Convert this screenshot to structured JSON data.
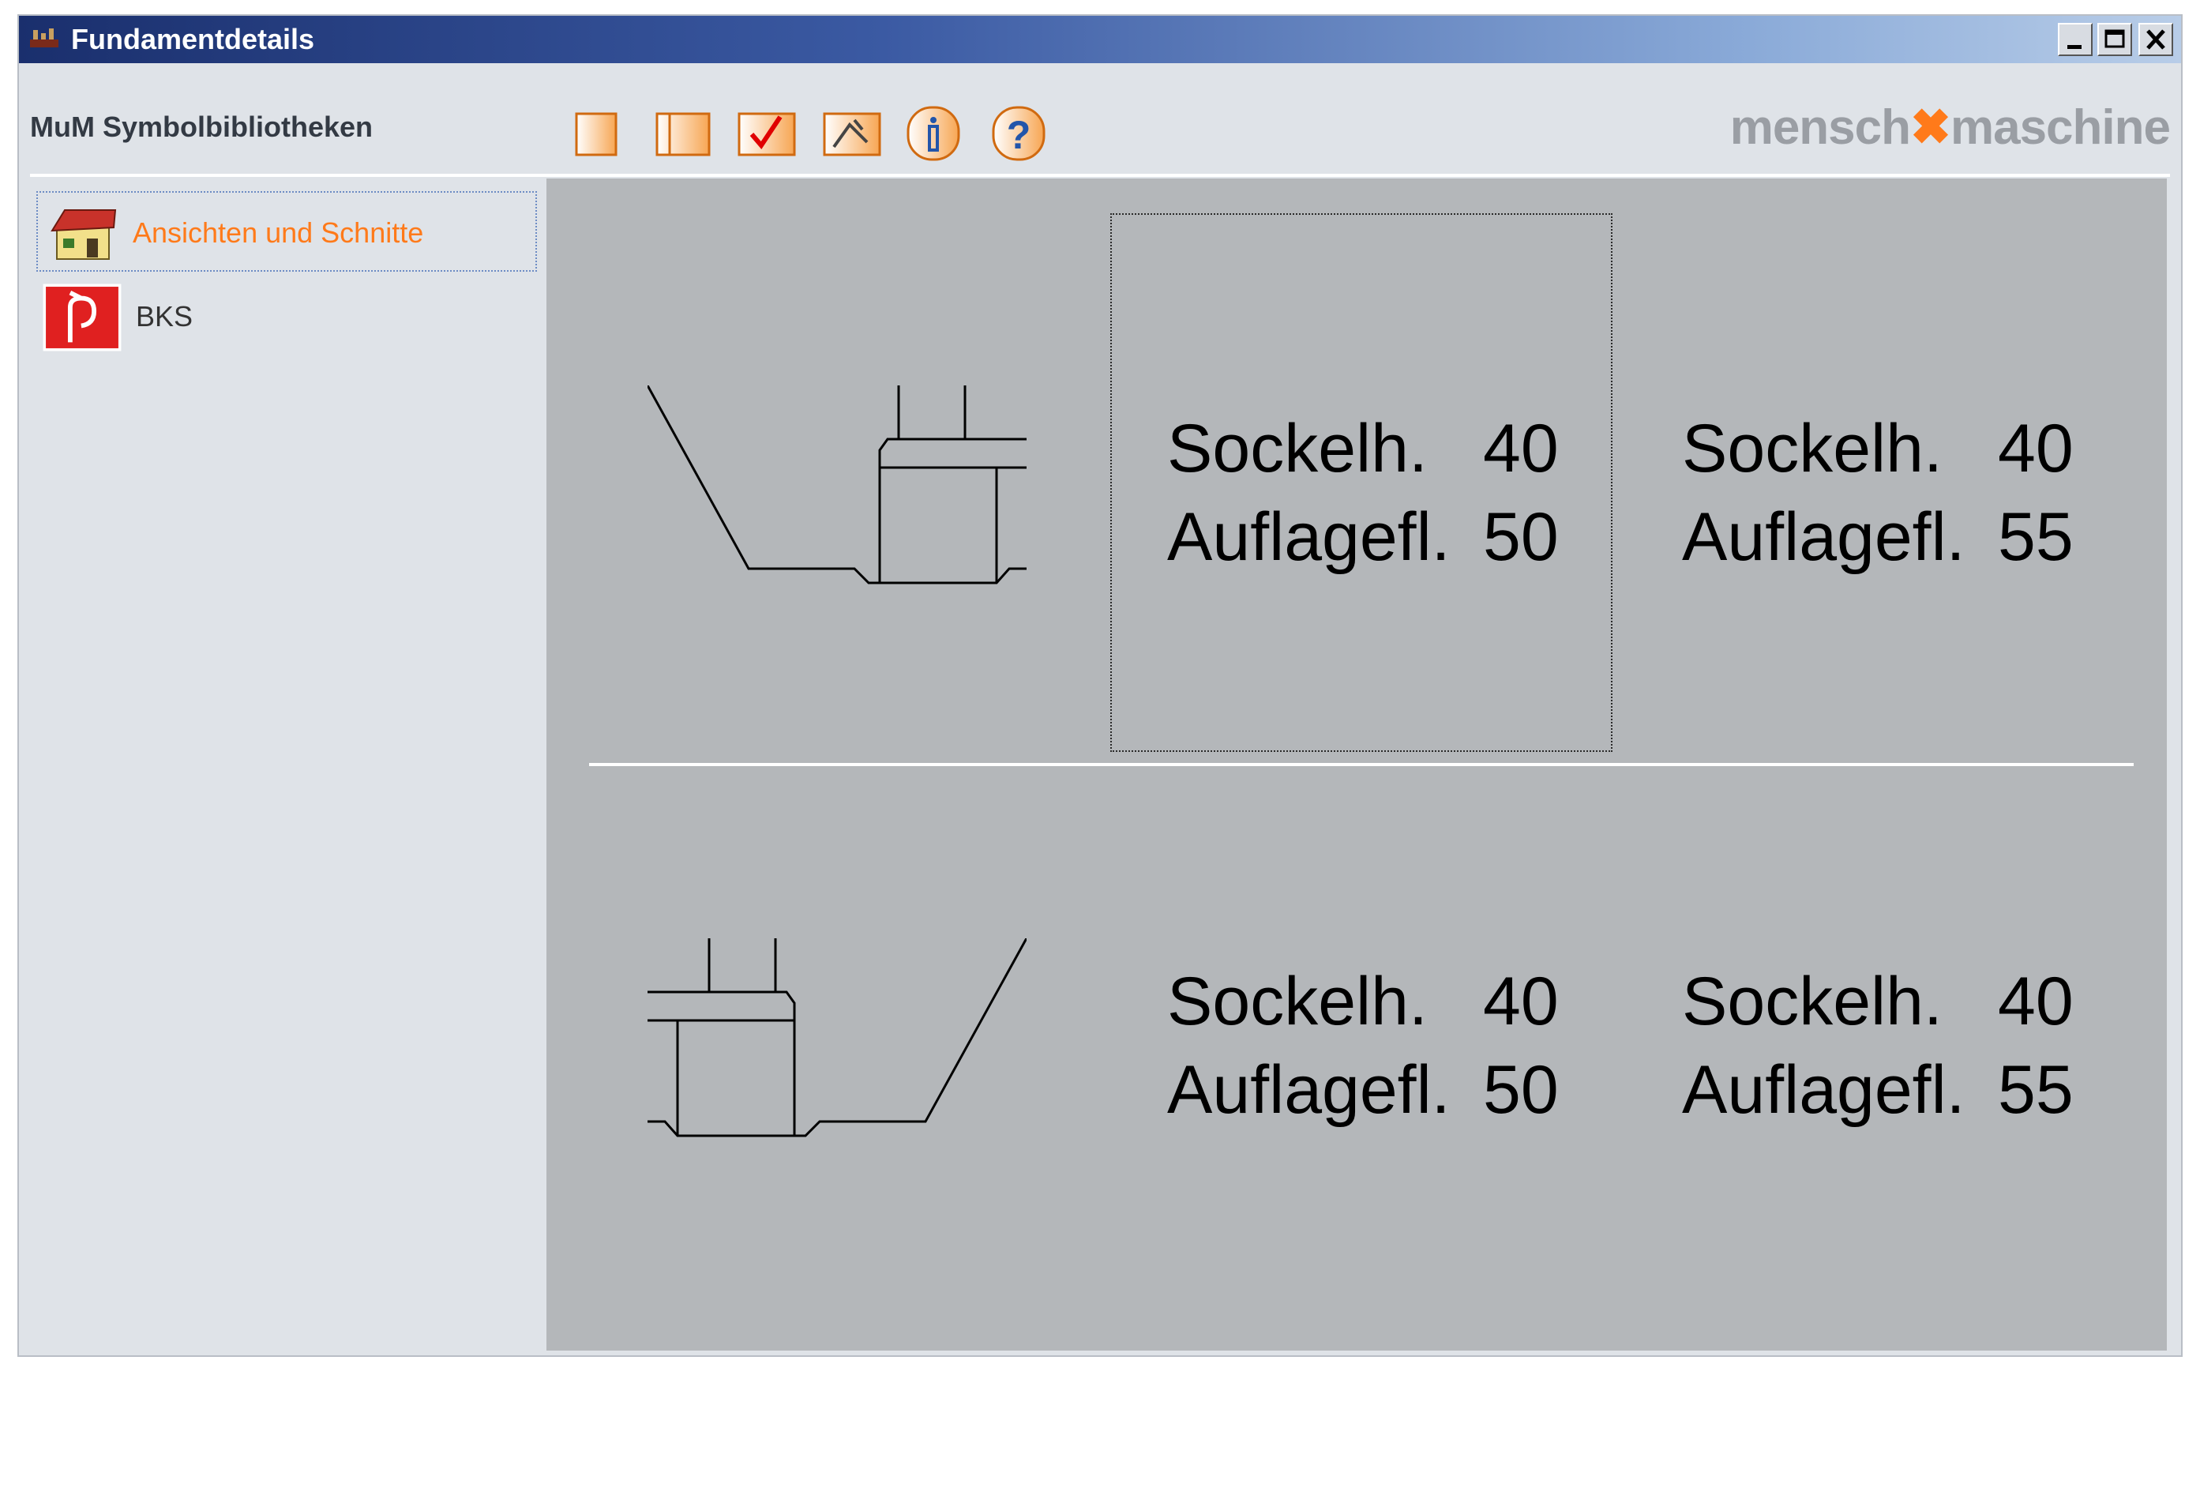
{
  "window": {
    "title": "Fundamentdetails",
    "icons": {
      "app": "app-icon",
      "minimize": "minimize-icon",
      "maximize": "maximize-icon",
      "close": "close-icon"
    }
  },
  "header": {
    "library_title": "MuM Symbolbibliotheken",
    "brand_left": "mensch",
    "brand_right": "maschine",
    "toolbar_icons": [
      "blank-page-icon",
      "page-panel-icon",
      "checkmark-icon",
      "edit-icon",
      "info-icon",
      "help-icon"
    ]
  },
  "sidebar": {
    "items": [
      {
        "label": "Ansichten und Schnitte",
        "icon": "house-icon",
        "selected": true
      },
      {
        "label": "BKS",
        "icon": "fire-extinguisher-icon",
        "selected": false
      }
    ]
  },
  "symbols": {
    "rows": [
      {
        "cells": [
          {
            "label1": "Sockelh.",
            "value1": "40",
            "label2": "Auflagefl.",
            "value2": "50",
            "focused": true
          },
          {
            "label1": "Sockelh.",
            "value1": "40",
            "label2": "Auflagefl.",
            "value2": "55"
          }
        ]
      },
      {
        "cells": [
          {
            "label1": "Sockelh.",
            "value1": "40",
            "label2": "Auflagefl.",
            "value2": "50"
          },
          {
            "label1": "Sockelh.",
            "value1": "40",
            "label2": "Auflagefl.",
            "value2": "55"
          }
        ]
      }
    ]
  },
  "colors": {
    "accent": "#ff7a1a",
    "titlebar_dark": "#1a2f6d",
    "panel": "#b4b7ba"
  }
}
